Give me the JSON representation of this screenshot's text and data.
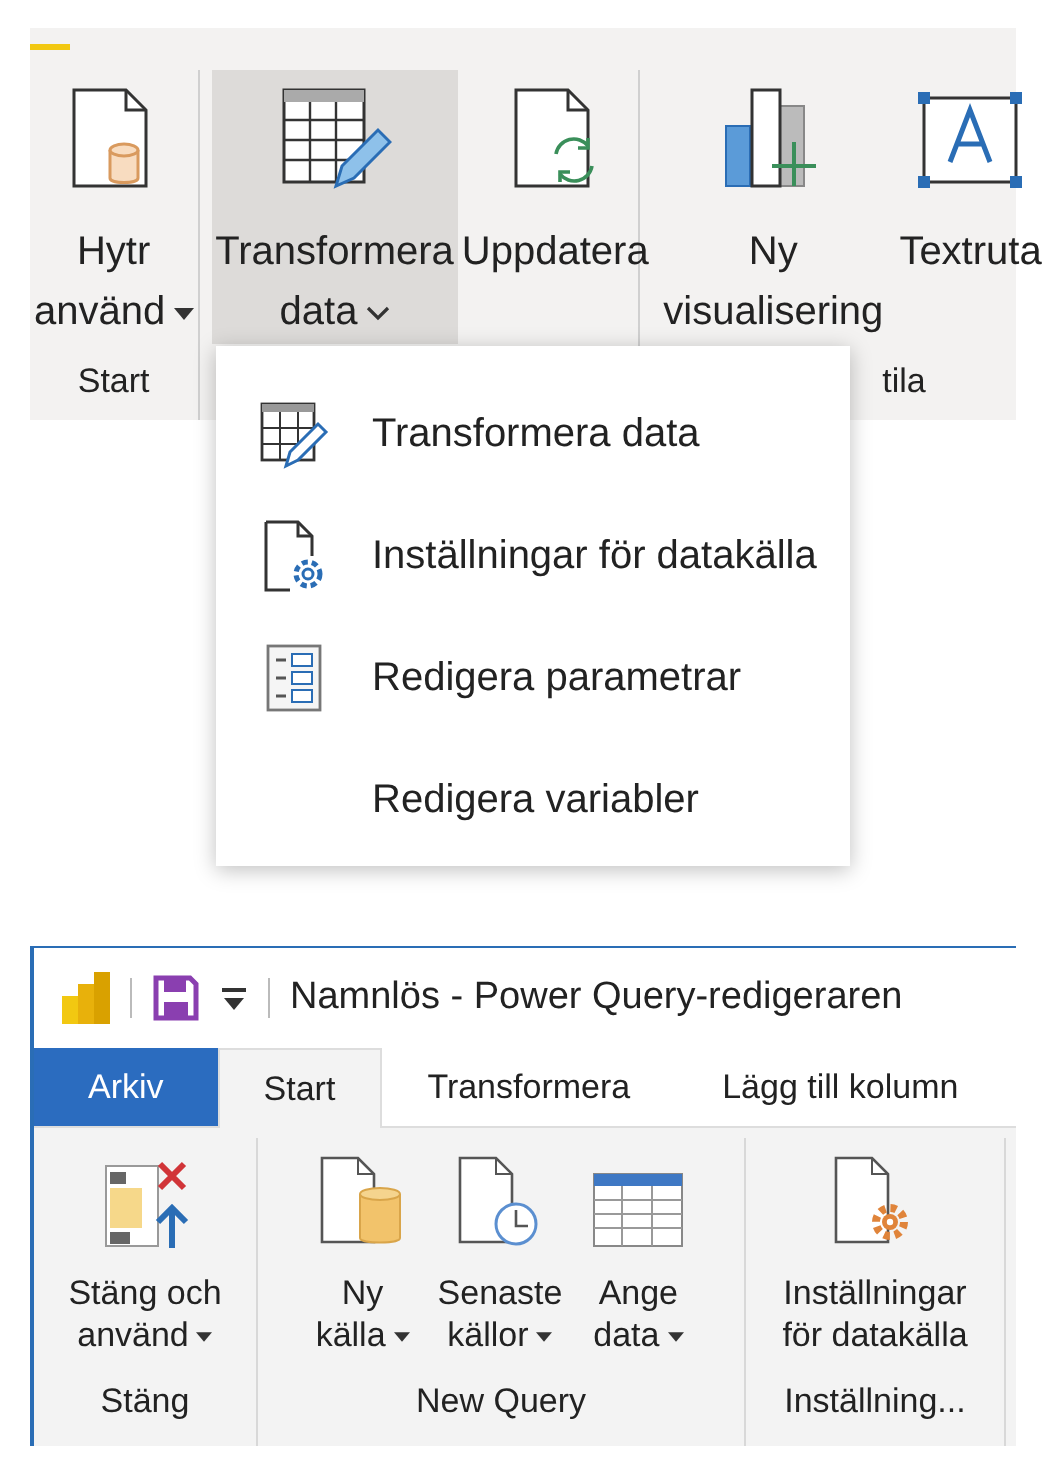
{
  "report_ribbon": {
    "groups": [
      {
        "label": "Start",
        "buttons": [
          {
            "lines": [
              "Hytr",
              "använd"
            ],
            "kind": "dropdown",
            "selected": false
          }
        ]
      },
      {
        "buttons": [
          {
            "lines": [
              "Transformera",
              "data"
            ],
            "kind": "menu",
            "selected": true
          },
          {
            "lines": [
              "Uppdatera"
            ],
            "kind": "plain",
            "selected": false
          }
        ]
      },
      {
        "label": "tila",
        "buttons": [
          {
            "lines": [
              "Ny",
              "visualisering"
            ],
            "kind": "plain",
            "selected": false
          },
          {
            "lines": [
              "Textruta"
            ],
            "kind": "plain",
            "selected": false
          }
        ]
      }
    ]
  },
  "dropdown_menu": {
    "items": [
      {
        "label": "Transformera data"
      },
      {
        "label": "Inställningar för datakälla"
      },
      {
        "label": "Redigera parametrar"
      },
      {
        "label": "Redigera variabler"
      }
    ]
  },
  "editor": {
    "title": "Namnlös - Power Query-redigeraren",
    "tabs": [
      {
        "label": "Arkiv",
        "kind": "file",
        "selected": false
      },
      {
        "label": "Start",
        "kind": "tab",
        "selected": true
      },
      {
        "label": "Transformera",
        "kind": "tab",
        "selected": false
      },
      {
        "label": "Lägg till kolumn",
        "kind": "tab",
        "selected": false
      }
    ],
    "groups": [
      {
        "label": "Stäng",
        "buttons": [
          {
            "lines": [
              "Stäng och",
              "använd"
            ],
            "kind": "dropdown"
          }
        ]
      },
      {
        "label": "New Query",
        "buttons": [
          {
            "lines": [
              "Ny",
              "källa"
            ],
            "kind": "dropdown"
          },
          {
            "lines": [
              "Senaste",
              "källor"
            ],
            "kind": "dropdown"
          },
          {
            "lines": [
              "Ange",
              "data"
            ],
            "kind": "dropdown"
          }
        ]
      },
      {
        "label": "Inställning...",
        "buttons": [
          {
            "lines": [
              "Inställningar",
              "för datakälla"
            ],
            "kind": "plain"
          }
        ]
      }
    ]
  }
}
